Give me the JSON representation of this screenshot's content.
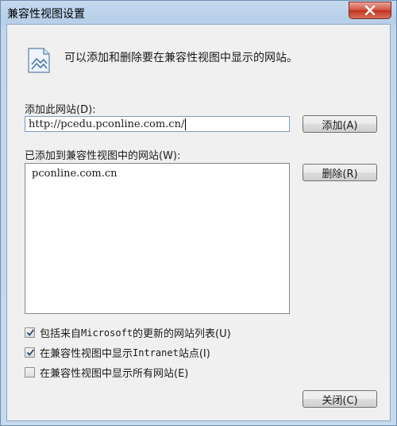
{
  "window": {
    "title": "兼容性视图设置"
  },
  "info": {
    "text": "可以添加和删除要在兼容性视图中显示的网站。",
    "icon": "web-page-icon"
  },
  "add_site": {
    "label": "添加此网站(D):",
    "value": "http://pcedu.pconline.com.cn/",
    "button_label": "添加(A)"
  },
  "list": {
    "label": "已添加到兼容性视图中的网站(W):",
    "items": [
      "pconline.com.cn"
    ],
    "remove_label": "删除(R)"
  },
  "options": [
    {
      "prefix": "包括来自 ",
      "mono": "Microsoft",
      "suffix": " 的更新的网站列表(U)",
      "checked": true
    },
    {
      "prefix": "在兼容性视图中显示 ",
      "mono": "Intranet",
      "suffix": " 站点(I)",
      "checked": true
    },
    {
      "prefix": "在兼容性视图中显示所有网站(E)",
      "mono": "",
      "suffix": "",
      "checked": false
    }
  ],
  "footer": {
    "close_label": "关闭(C)"
  },
  "colors": {
    "titlebar": "#b7cfe9",
    "close_red": "#c2331f",
    "client_bg": "#f0f0f0"
  }
}
